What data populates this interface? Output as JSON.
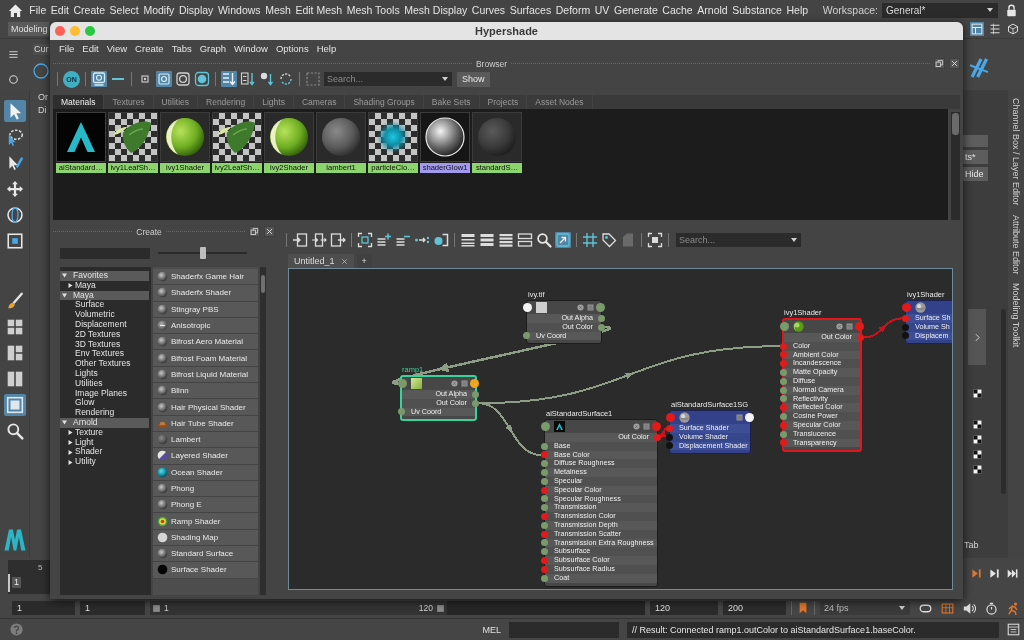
{
  "menubar": {
    "items": [
      "File",
      "Edit",
      "Create",
      "Select",
      "Modify",
      "Display",
      "Windows",
      "Mesh",
      "Edit Mesh",
      "Mesh Tools",
      "Mesh Display",
      "Curves",
      "Surfaces",
      "Deform",
      "UV",
      "Generate",
      "Cache",
      "Arnold",
      "Substance",
      "Help"
    ],
    "workspace_label": "Workspace:",
    "workspace": "General*"
  },
  "status_line": {
    "menu_set": "Modeling"
  },
  "shelf": {
    "tab": "Cur"
  },
  "tool_box": {
    "tools": [
      {
        "kind": "select",
        "selected": true
      },
      {
        "kind": "lasso",
        "selected": false
      },
      {
        "kind": "paint",
        "selected": false
      },
      {
        "kind": "move",
        "selected": false
      },
      {
        "kind": "rotate",
        "selected": false
      },
      {
        "kind": "scale",
        "selected": false
      }
    ],
    "panels": [
      {
        "kind": "brush",
        "selected": false
      },
      {
        "kind": "quad",
        "selected": false
      },
      {
        "kind": "side",
        "selected": false
      },
      {
        "kind": "split",
        "selected": false
      },
      {
        "kind": "single",
        "selected": true
      },
      {
        "kind": "search",
        "selected": false
      }
    ]
  },
  "outliner": {
    "rows": [
      "Or",
      "Di"
    ]
  },
  "right_dock": {
    "buttons": [
      "ts*",
      "Hide"
    ],
    "tabs": [
      "Channel Box / Layer Editor",
      "Attribute Editor",
      "Modeling Toolkit"
    ],
    "toolkit_label": "Tab"
  },
  "hypershade": {
    "title": "Hypershade",
    "menu": [
      "File",
      "Edit",
      "View",
      "Create",
      "Tabs",
      "Graph",
      "Window",
      "Options",
      "Help"
    ],
    "browser": {
      "title": "Browser",
      "toolbar": [
        [
          {
            "kind": "power",
            "label": "ON",
            "on": false
          }
        ],
        [
          {
            "kind": "swatch_view",
            "on": true
          },
          {
            "kind": "list_view",
            "on": false
          }
        ],
        [
          {
            "kind": "size_small",
            "on": false
          },
          {
            "kind": "size_medium",
            "on": true
          },
          {
            "kind": "size_large",
            "on": false
          },
          {
            "kind": "size_xlarge",
            "on": false
          }
        ],
        [
          {
            "kind": "sort_name",
            "on": true
          },
          {
            "kind": "sort_type",
            "on": false
          },
          {
            "kind": "sort_time",
            "on": false
          },
          {
            "kind": "sort_reverse",
            "on": false
          }
        ],
        [
          {
            "kind": "select_frame",
            "on": false
          }
        ]
      ],
      "search": {
        "placeholder": "Search..."
      },
      "show_button": "Show",
      "tabs": [
        {
          "label": "Materials",
          "selected": true
        },
        {
          "label": "Textures",
          "selected": false
        },
        {
          "label": "Utilities",
          "selected": false
        },
        {
          "label": "Rendering",
          "selected": false
        },
        {
          "label": "Lights",
          "selected": false
        },
        {
          "label": "Cameras",
          "selected": false
        },
        {
          "label": "Shading Groups",
          "selected": false
        },
        {
          "label": "Bake Sets",
          "selected": false
        },
        {
          "label": "Projects",
          "selected": false
        },
        {
          "label": "Asset Nodes",
          "selected": false
        }
      ],
      "swatches": [
        {
          "label": "aiStandard…",
          "kind": "arnold",
          "selected": false
        },
        {
          "label": "ivy1LeafSh…",
          "kind": "leaf",
          "selected": false
        },
        {
          "label": "ivy1Shader",
          "kind": "green_sphere",
          "selected": false
        },
        {
          "label": "ivy2LeafSh…",
          "kind": "leaf",
          "selected": false
        },
        {
          "label": "ivy2Shader",
          "kind": "green_sphere",
          "selected": false
        },
        {
          "label": "lambert1",
          "kind": "gray_sphere",
          "selected": false
        },
        {
          "label": "particleClo…",
          "kind": "particle",
          "selected": false
        },
        {
          "label": "shaderGlow1",
          "kind": "glow",
          "selected": true
        },
        {
          "label": "standardS…",
          "kind": "dark_sphere",
          "selected": false
        }
      ]
    },
    "create": {
      "title": "Create",
      "slider": {
        "level": 0.5
      },
      "tree": [
        {
          "label": "Favorites",
          "expanded": true,
          "children": [
            {
              "label": "Maya",
              "expanded": false
            }
          ]
        },
        {
          "label": "Maya",
          "expanded": true,
          "children": [
            {
              "label": "Surface"
            },
            {
              "label": "Volumetric"
            },
            {
              "label": "Displacement"
            },
            {
              "label": "2D Textures"
            },
            {
              "label": "3D Textures"
            },
            {
              "label": "Env Textures"
            },
            {
              "label": "Other Textures"
            },
            {
              "label": "Lights"
            },
            {
              "label": "Utilities"
            },
            {
              "label": "Image Planes"
            },
            {
              "label": "Glow"
            },
            {
              "label": "Rendering"
            }
          ]
        },
        {
          "label": "Arnold",
          "expanded": true,
          "children": [
            {
              "label": "Texture",
              "expanded": false
            },
            {
              "label": "Light",
              "expanded": false
            },
            {
              "label": "Shader",
              "expanded": false
            },
            {
              "label": "Utility",
              "expanded": false
            }
          ]
        }
      ],
      "list": [
        {
          "label": "Shaderfx Game Hair",
          "kind": "sphere"
        },
        {
          "label": "Shaderfx Shader",
          "kind": "sphere"
        },
        {
          "label": "Stingray PBS",
          "kind": "sphere"
        },
        {
          "label": "Anisotropic",
          "kind": "flat"
        },
        {
          "label": "Bifrost Aero Material",
          "kind": "sphere"
        },
        {
          "label": "Bifrost Foam Material",
          "kind": "sphere"
        },
        {
          "label": "Bifrost Liquid Material",
          "kind": "sphere"
        },
        {
          "label": "Blinn",
          "kind": "sphere"
        },
        {
          "label": "Hair Physical Shader",
          "kind": "sphere"
        },
        {
          "label": "Hair Tube Shader",
          "kind": "hair_tube"
        },
        {
          "label": "Lambert",
          "kind": "lambert"
        },
        {
          "label": "Layered Shader",
          "kind": "layered"
        },
        {
          "label": "Ocean Shader",
          "kind": "ocean"
        },
        {
          "label": "Phong",
          "kind": "sphere"
        },
        {
          "label": "Phong E",
          "kind": "sphere"
        },
        {
          "label": "Ramp Shader",
          "kind": "ramp"
        },
        {
          "label": "Shading Map",
          "kind": "shading_map"
        },
        {
          "label": "Standard Surface",
          "kind": "sphere"
        },
        {
          "label": "Surface Shader",
          "kind": "black"
        }
      ]
    },
    "node_editor": {
      "toolbar": [
        [
          {
            "kind": "input_connections",
            "on": false
          },
          {
            "kind": "io_connections",
            "on": false
          },
          {
            "kind": "output_connections",
            "on": false
          }
        ],
        [
          {
            "kind": "frame_selection",
            "on": false
          },
          {
            "kind": "add_rows",
            "on": false
          },
          {
            "kind": "remove_rows",
            "on": false
          },
          {
            "kind": "arrow_dots",
            "on": false
          },
          {
            "kind": "dot_bracket",
            "on": false
          }
        ],
        [
          {
            "kind": "rows_one",
            "on": false
          },
          {
            "kind": "rows_two",
            "on": false
          },
          {
            "kind": "rows_three",
            "on": false
          },
          {
            "kind": "rows_four",
            "on": false
          },
          {
            "kind": "search",
            "on": false
          },
          {
            "kind": "square_arrow",
            "on": true
          }
        ],
        [
          {
            "kind": "grid",
            "on": false
          },
          {
            "kind": "tag",
            "on": false
          },
          {
            "kind": "page",
            "on": false
          }
        ],
        [
          {
            "kind": "frame_all",
            "on": false
          }
        ]
      ],
      "search": {
        "placeholder": "Search..."
      },
      "tabs": [
        {
          "label": "Untitled_1",
          "selected": true
        }
      ],
      "new_tab": "+",
      "graph": {
        "nodes": [
          {
            "name": "ivy.tif",
            "kind": "file_texture",
            "selected": false,
            "highlighted": false,
            "in_port": {
              "color": "#f4f4f4"
            },
            "out_port": {
              "color": "#7a9a6c"
            },
            "attrs": [
              {
                "label": "Out Alpha",
                "kind": "output",
                "color": "#7a9a6c"
              },
              {
                "label": "Out Color",
                "kind": "output",
                "color": "#7a9a6c"
              },
              {
                "label": "Uv Coord",
                "kind": "input",
                "color": "#7a9a6c"
              }
            ]
          },
          {
            "name": "ramp1",
            "kind": "ramp",
            "selected": true,
            "highlighted": false,
            "in_port": {
              "color": "#7a9a6c"
            },
            "out_port": {
              "color": "#f2a51c"
            },
            "attrs": [
              {
                "label": "Out Alpha",
                "kind": "output",
                "color": "#7a9a6c"
              },
              {
                "label": "Out Color",
                "kind": "output",
                "color": "#7a9a6c"
              },
              {
                "label": "Uv Coord",
                "kind": "input",
                "color": "#7a9a6c"
              }
            ]
          },
          {
            "name": "aiStandardSurface1",
            "kind": "arnold_shader",
            "selected": false,
            "highlighted": false,
            "in_port": {
              "color": "#7a9a6c"
            },
            "out_port": {
              "color": "#e41a1a"
            },
            "attrs": [
              {
                "label": "Out Color",
                "kind": "output",
                "color": "#e41a1a"
              },
              {
                "label": "Base",
                "kind": "input",
                "color": "#7a9a6c"
              },
              {
                "label": "Base Color",
                "kind": "input",
                "color": "#e41a1a"
              },
              {
                "label": "Diffuse Roughness",
                "kind": "input",
                "color": "#7a9a6c"
              },
              {
                "label": "Metalness",
                "kind": "input",
                "color": "#7a9a6c"
              },
              {
                "label": "Specular",
                "kind": "input",
                "color": "#7a9a6c"
              },
              {
                "label": "Specular Color",
                "kind": "input",
                "color": "#e41a1a"
              },
              {
                "label": "Specular Roughness",
                "kind": "input",
                "color": "#7a9a6c"
              },
              {
                "label": "Transmission",
                "kind": "input",
                "color": "#7a9a6c"
              },
              {
                "label": "Transmission Color",
                "kind": "input",
                "color": "#e41a1a"
              },
              {
                "label": "Transmission Depth",
                "kind": "input",
                "color": "#7a9a6c"
              },
              {
                "label": "Transmission Scatter",
                "kind": "input",
                "color": "#e41a1a"
              },
              {
                "label": "Transmission Extra Roughness",
                "kind": "input",
                "color": "#7a9a6c"
              },
              {
                "label": "Subsurface",
                "kind": "input",
                "color": "#7a9a6c"
              },
              {
                "label": "Subsurface Color",
                "kind": "input",
                "color": "#e41a1a"
              },
              {
                "label": "Subsurface Radius",
                "kind": "input",
                "color": "#e41a1a"
              },
              {
                "label": "Coat",
                "kind": "input",
                "color": "#7a9a6c"
              }
            ]
          },
          {
            "name": "aiStandardSurface1SG",
            "kind": "shading_group",
            "selected": false,
            "highlighted": false,
            "in_port": {
              "color": "#e41a1a"
            },
            "out_port": {
              "color": "#f4f4f4"
            },
            "attrs": [
              {
                "label": "Surface Shader",
                "kind": "input",
                "color": "#e41a1a"
              },
              {
                "label": "Volume Shader",
                "kind": "input",
                "color": "#111111"
              },
              {
                "label": "Displacement Shader",
                "kind": "input",
                "color": "#111111"
              }
            ]
          },
          {
            "name": "ivy1Shader",
            "kind": "lambert_shader",
            "selected": false,
            "highlighted": true,
            "in_port": {
              "color": "#7a9a6c"
            },
            "out_port": {
              "color": "#e41a1a"
            },
            "attrs": [
              {
                "label": "Out Color",
                "kind": "output",
                "color": "#e41a1a"
              },
              {
                "label": "Color",
                "kind": "input",
                "color": "#e41a1a"
              },
              {
                "label": "Ambient Color",
                "kind": "input",
                "color": "#e41a1a"
              },
              {
                "label": "Incandescence",
                "kind": "input",
                "color": "#e41a1a"
              },
              {
                "label": "Matte Opacity",
                "kind": "input",
                "color": "#7a9a6c"
              },
              {
                "label": "Diffuse",
                "kind": "input",
                "color": "#7a9a6c"
              },
              {
                "label": "Normal Camera",
                "kind": "input",
                "color": "#7a9a6c"
              },
              {
                "label": "Reflectivity",
                "kind": "input",
                "color": "#7a9a6c"
              },
              {
                "label": "Reflected Color",
                "kind": "input",
                "color": "#e41a1a"
              },
              {
                "label": "Cosine Power",
                "kind": "input",
                "color": "#7a9a6c"
              },
              {
                "label": "Specular Color",
                "kind": "input",
                "color": "#e41a1a"
              },
              {
                "label": "Translucence",
                "kind": "input",
                "color": "#7a9a6c"
              },
              {
                "label": "Transparency",
                "kind": "input",
                "color": "#e41a1a"
              }
            ]
          },
          {
            "name": "ivy1Shader",
            "kind": "shading_group",
            "selected": false,
            "highlighted": false,
            "in_port": {
              "color": "#e41a1a"
            },
            "attrs": [
              {
                "label": "Surface Sh",
                "kind": "input",
                "color": "#e41a1a"
              },
              {
                "label": "Volume Sh",
                "kind": "input",
                "color": "#111111"
              },
              {
                "label": "Displacem",
                "kind": "input",
                "color": "#111111"
              }
            ]
          }
        ],
        "connections": [
          {
            "color": "#8e9e86"
          },
          {
            "color": "#8e9e86"
          },
          {
            "color": "#8e9e86"
          },
          {
            "color": "#c8141c"
          },
          {
            "color": "#c8141c"
          }
        ]
      }
    }
  },
  "time_slider": {
    "tick": "5",
    "current_frame": "1",
    "level": 0
  },
  "range_slider": {
    "start": "1",
    "playback_start": "1",
    "slider_start": "1",
    "slider_end": "120",
    "level": 0.6,
    "playback_end": "120",
    "end": "200",
    "fps": "24 fps"
  },
  "command_line": {
    "language": "MEL",
    "result": "// Result: Connected ramp1.outColor to aiStandardSurface1.baseColor."
  }
}
